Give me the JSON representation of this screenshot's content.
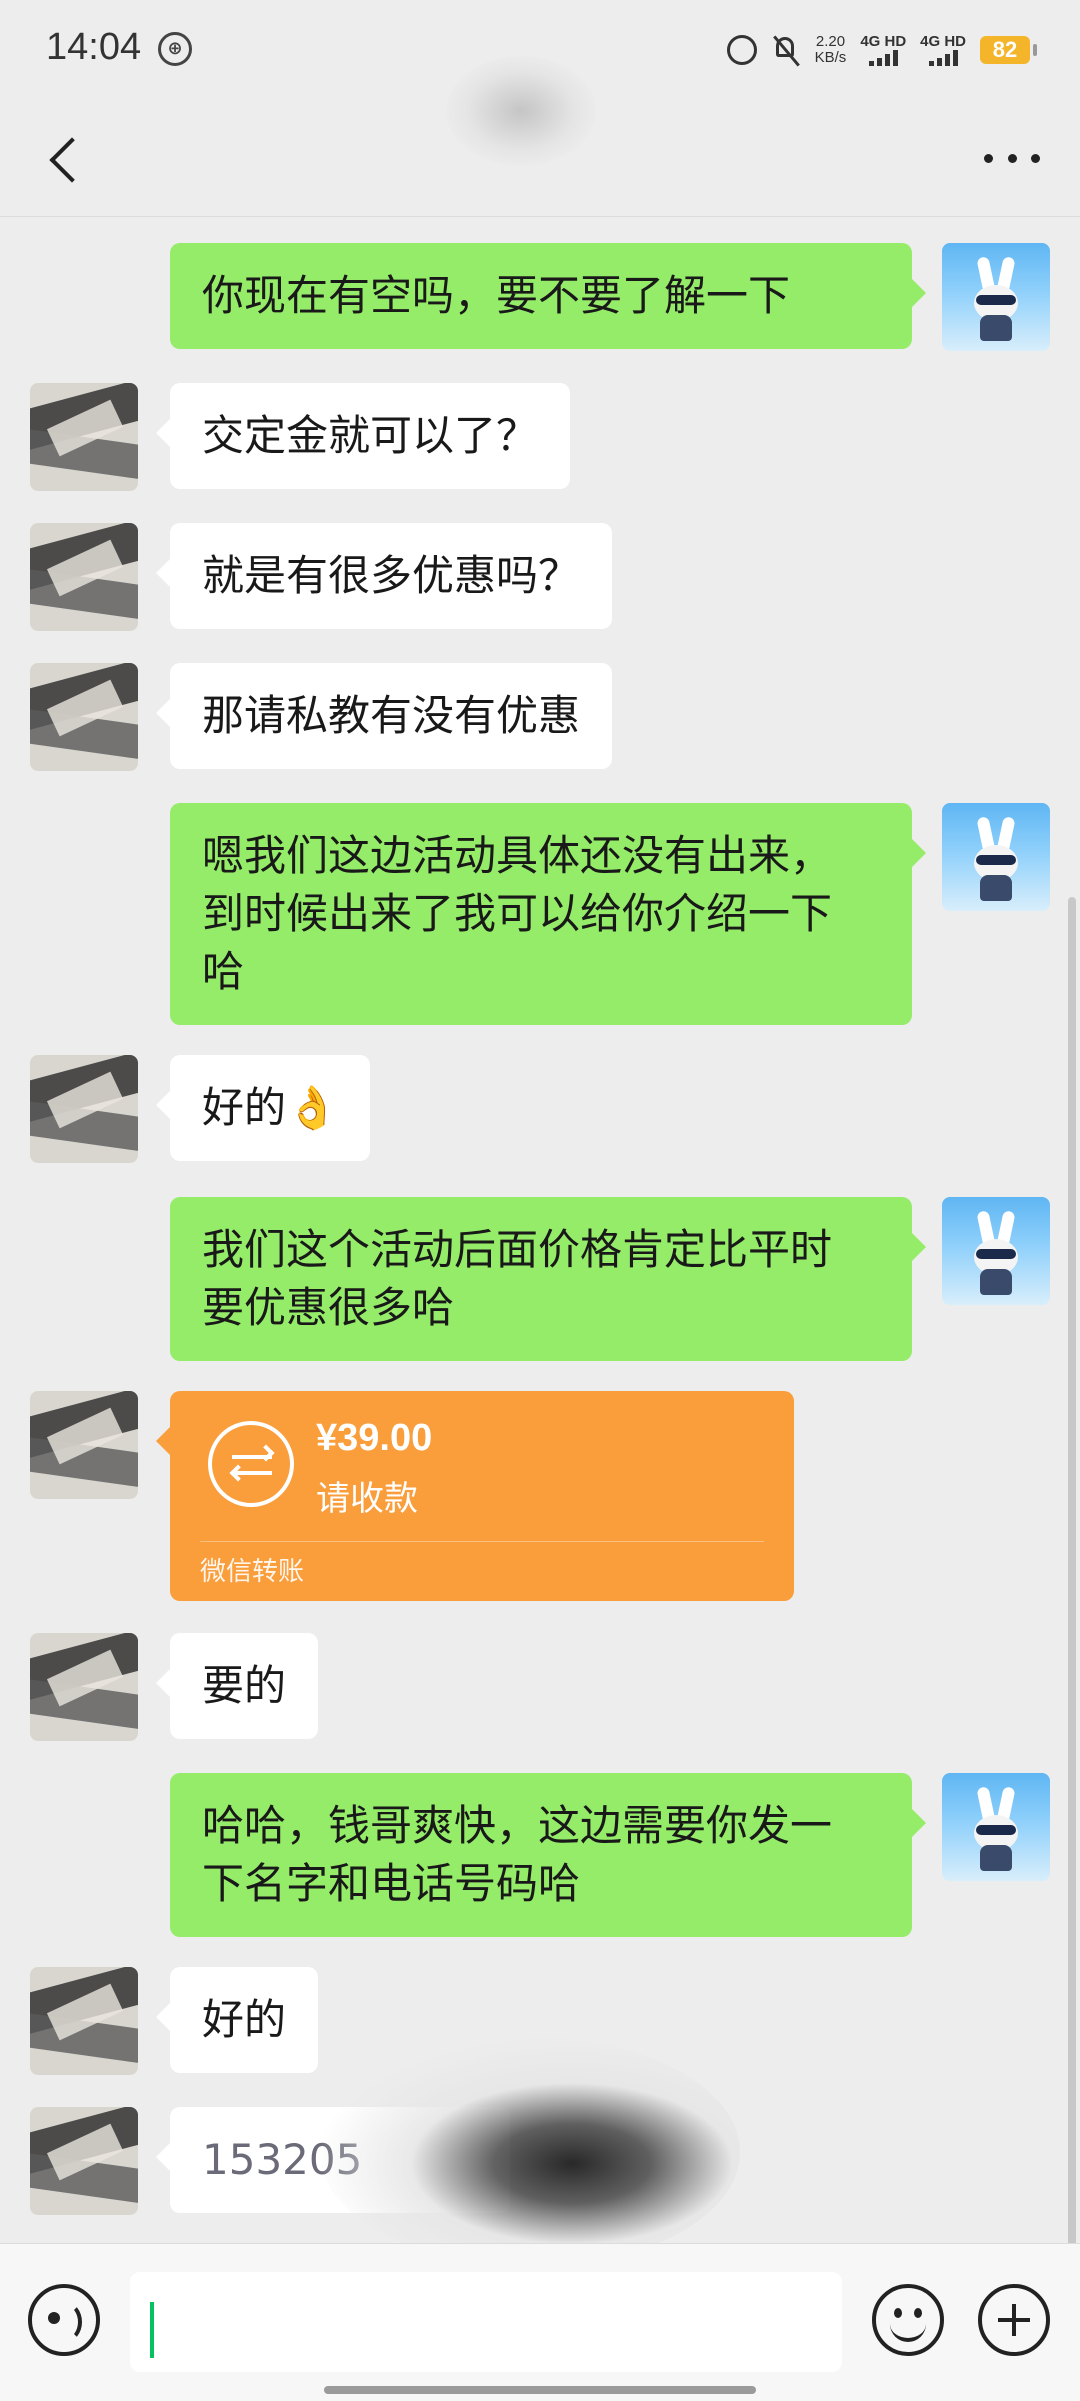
{
  "status_bar": {
    "time": "14:04",
    "net_speed": "2.20",
    "net_speed_unit": "KB/s",
    "sim1": "4G HD",
    "sim2": "4G HD",
    "battery": "82"
  },
  "header": {
    "title": ""
  },
  "messages": [
    {
      "side": "out",
      "text": "你现在有空吗，要不要了解一下"
    },
    {
      "side": "in",
      "text": "交定金就可以了？"
    },
    {
      "side": "in",
      "text": "就是有很多优惠吗？"
    },
    {
      "side": "in",
      "text": "那请私教有没有优惠"
    },
    {
      "side": "out",
      "text": "嗯我们这边活动具体还没有出来，\n到时候出来了我可以给你介绍一下\n哈"
    },
    {
      "side": "in",
      "text": "好的👌"
    },
    {
      "side": "out",
      "text": "我们这个活动后面价格肯定比平时\n要优惠很多哈"
    },
    {
      "side": "in",
      "type": "transfer",
      "amount": "¥39.00",
      "status": "请收款",
      "label": "微信转账"
    },
    {
      "side": "in",
      "text": "要的"
    },
    {
      "side": "out",
      "text": "哈哈，钱哥爽快，这边需要你发一\n下名字和电话号码哈"
    },
    {
      "side": "in",
      "text": "好的"
    },
    {
      "side": "in",
      "text": "153205"
    }
  ],
  "input": {
    "value": ""
  },
  "icons": {
    "back": "back-arrow-icon",
    "more": "more-dots-icon",
    "voice": "voice-icon",
    "emoji": "emoji-icon",
    "plus": "plus-icon"
  },
  "colors": {
    "outgoing_bubble": "#95ec69",
    "incoming_bubble": "#ffffff",
    "transfer_card": "#fa9d3b",
    "background": "#ededed",
    "battery": "#f5b52a"
  }
}
